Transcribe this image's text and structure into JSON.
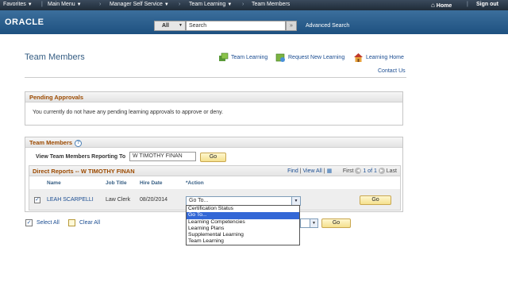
{
  "topbar": {
    "favorites": "Favorites",
    "main_menu": "Main Menu",
    "breadcrumb": [
      "Manager Self Service",
      "Team Learning",
      "Team Members"
    ],
    "home": "Home",
    "sign_out": "Sign out"
  },
  "header": {
    "logo": "ORACLE",
    "search_scope": "All",
    "search_placeholder": "Search",
    "advanced_search": "Advanced Search"
  },
  "page": {
    "title": "Team Members",
    "links": {
      "team_learning": "Team Learning",
      "request_new_learning": "Request New Learning",
      "learning_home": "Learning Home",
      "contact_us": "Contact Us"
    }
  },
  "pending": {
    "title": "Pending Approvals",
    "message": "You currently do not have any pending learning approvals to approve or deny."
  },
  "team": {
    "title": "Team Members",
    "view_label": "View Team Members Reporting To",
    "view_value": "W TIMOTHY FINAN",
    "go_label": "Go",
    "grid": {
      "title": "Direct Reports -- W TIMOTHY FINAN",
      "find": "Find",
      "sep": "|",
      "view_all": "View All",
      "first": "First",
      "page_info": "1 of 1",
      "last": "Last",
      "columns": {
        "name": "Name",
        "job_title": "Job Title",
        "hire_date": "Hire Date",
        "action": "*Action"
      },
      "row": {
        "name": "LEAH SCARPELLI",
        "job_title": "Law Clerk",
        "hire_date": "08/20/2014",
        "action_value": "Go To...",
        "go_label": "Go"
      },
      "action_options": [
        "Certification Status",
        "Go To...",
        "Learning Competencies",
        "Learning Plans",
        "Supplemental Learning",
        "Team Learning"
      ]
    },
    "select_all": "Select All",
    "clear_all": "Clear All",
    "bottom_go": "Go"
  },
  "colors": {
    "section_title": "#9c4a00",
    "link": "#1a4c91",
    "dropdown_selected": "#3367d6"
  }
}
